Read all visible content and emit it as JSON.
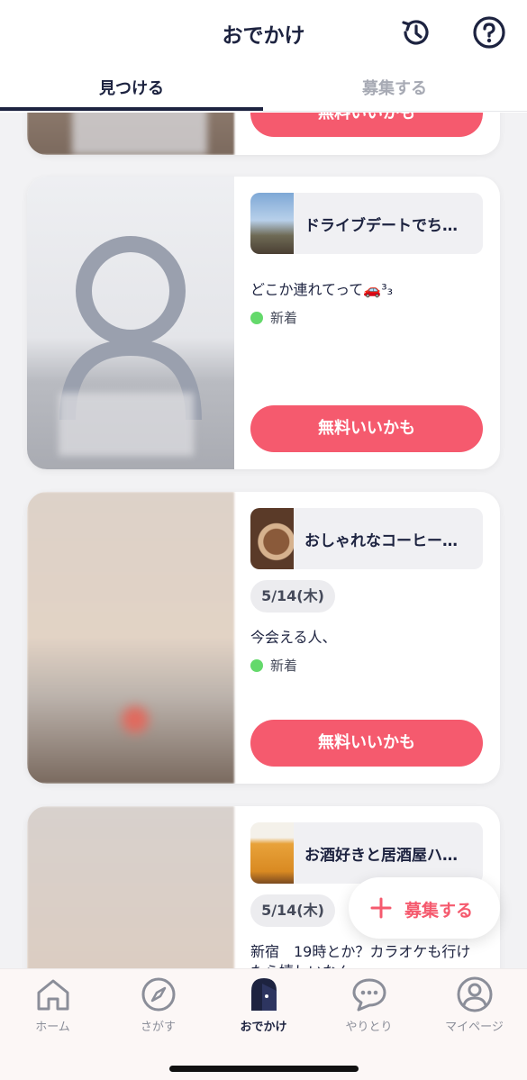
{
  "header": {
    "title": "おでかけ",
    "history_icon": "history-icon",
    "help_icon": "help-icon"
  },
  "tabs": [
    {
      "label": "見つける",
      "active": true
    },
    {
      "label": "募集する",
      "active": false
    }
  ],
  "cards": [
    {
      "cta_label": "無料いいかも"
    },
    {
      "plan_title": "ドライブデートでち…",
      "message": "どこか連れてって🚗³₃",
      "status": "新着",
      "cta_label": "無料いいかも"
    },
    {
      "plan_title": "おしゃれなコーヒー…",
      "date": "5/14(木)",
      "message": "今会える人、",
      "status": "新着",
      "cta_label": "無料いいかも"
    },
    {
      "plan_title": "お酒好きと居酒屋ハ…",
      "date": "5/14(木)",
      "message": "新宿　19時とか？カラオケも行け",
      "message_line2": "たら嬉しいなん"
    }
  ],
  "fab": {
    "label": "募集する",
    "icon": "plus-icon"
  },
  "bottom_nav": [
    {
      "label": "ホーム",
      "icon": "home-icon",
      "active": false
    },
    {
      "label": "さがす",
      "icon": "compass-icon",
      "active": false
    },
    {
      "label": "おでかけ",
      "icon": "door-icon",
      "active": true
    },
    {
      "label": "やりとり",
      "icon": "chat-icon",
      "active": false
    },
    {
      "label": "マイページ",
      "icon": "user-icon",
      "active": false
    }
  ],
  "colors": {
    "accent": "#f55a6e",
    "navy": "#1d2340",
    "new_dot": "#64d96b"
  }
}
